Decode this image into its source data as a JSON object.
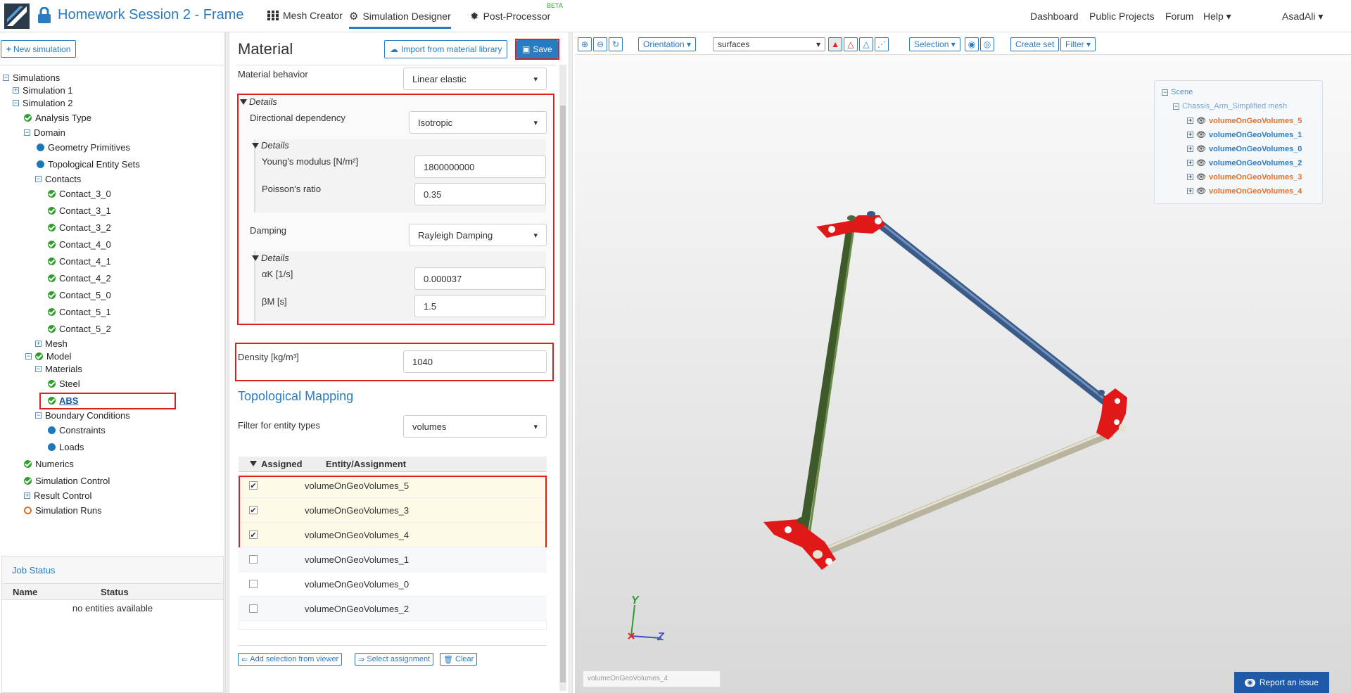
{
  "header": {
    "title": "Homework Session 2 - Frame",
    "nav": [
      "Mesh Creator",
      "Simulation Designer",
      "Post-Processor"
    ],
    "beta": "BETA",
    "right": [
      "Dashboard",
      "Public Projects",
      "Forum",
      "Help",
      "AsadAli"
    ]
  },
  "left": {
    "new_sim": "New simulation",
    "tree": [
      "Simulations",
      "Simulation 1",
      "Simulation 2",
      "Analysis Type",
      "Domain",
      "Geometry Primitives",
      "Topological Entity Sets",
      "Contacts",
      "Contact_3_0",
      "Contact_3_1",
      "Contact_3_2",
      "Contact_4_0",
      "Contact_4_1",
      "Contact_4_2",
      "Contact_5_0",
      "Contact_5_1",
      "Contact_5_2",
      "Mesh",
      "Model",
      "Materials",
      "Steel",
      "ABS",
      "Boundary Conditions",
      "Constraints",
      "Loads",
      "Numerics",
      "Simulation Control",
      "Result Control",
      "Simulation Runs"
    ],
    "job_status": {
      "title": "Job Status",
      "col_name": "Name",
      "col_status": "Status",
      "empty": "no entities available"
    }
  },
  "material": {
    "title": "Material",
    "import": "Import from material library",
    "save": "Save",
    "behavior_label": "Material behavior",
    "behavior_value": "Linear elastic",
    "details": "Details",
    "dir_label": "Directional dependency",
    "dir_value": "Isotropic",
    "young_label": "Young's modulus [N/m²]",
    "young_value": "1800000000",
    "poisson_label": "Poisson's ratio",
    "poisson_value": "0.35",
    "damping_label": "Damping",
    "damping_value": "Rayleigh Damping",
    "alpha_label": "αK [1/s]",
    "alpha_value": "0.000037",
    "beta_label": "βM [s]",
    "beta_value": "1.5",
    "density_label": "Density [kg/m³]",
    "density_value": "1040",
    "topo_title": "Topological Mapping",
    "filter_label": "Filter for entity types",
    "filter_value": "volumes",
    "col_assigned": "Assigned",
    "col_entity": "Entity/Assignment",
    "rows": [
      {
        "name": "volumeOnGeoVolumes_5",
        "checked": true
      },
      {
        "name": "volumeOnGeoVolumes_3",
        "checked": true
      },
      {
        "name": "volumeOnGeoVolumes_4",
        "checked": true
      },
      {
        "name": "volumeOnGeoVolumes_1",
        "checked": false
      },
      {
        "name": "volumeOnGeoVolumes_0",
        "checked": false
      },
      {
        "name": "volumeOnGeoVolumes_2",
        "checked": false
      }
    ],
    "add_sel": "Add selection from viewer",
    "select_assign": "Select assignment",
    "clear": "Clear"
  },
  "viewer": {
    "orientation": "Orientation",
    "surfaces": "surfaces",
    "selection": "Selection",
    "create_set": "Create set",
    "filter": "Filter",
    "scene": "Scene",
    "mesh": "Chassis_Arm_Simplified mesh",
    "scene_items": [
      {
        "name": "volumeOnGeoVolumes_5",
        "color": "#e0702a"
      },
      {
        "name": "volumeOnGeoVolumes_1",
        "color": "#2a7bbf"
      },
      {
        "name": "volumeOnGeoVolumes_0",
        "color": "#2a7bbf"
      },
      {
        "name": "volumeOnGeoVolumes_2",
        "color": "#2a7bbf"
      },
      {
        "name": "volumeOnGeoVolumes_3",
        "color": "#e0702a"
      },
      {
        "name": "volumeOnGeoVolumes_4",
        "color": "#e0702a"
      }
    ],
    "status_field": "volumeOnGeoVolumes_4",
    "report": "Report an issue",
    "axis_y": "Y",
    "axis_z": "Z"
  },
  "colors": {
    "accent": "#2a7bbf",
    "highlight": "#e02020",
    "ok": "#2e9e2e"
  }
}
